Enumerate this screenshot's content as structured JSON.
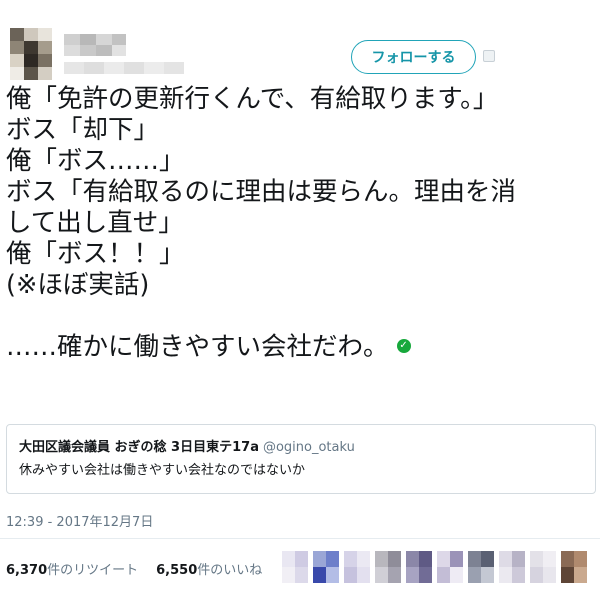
{
  "header": {
    "follow_label": "フォローする"
  },
  "tweet": {
    "lines": [
      "俺「免許の更新行くんで、有給取ります。」",
      "ボス「却下」",
      "俺「ボス……」",
      "ボス「有給取るのに理由は要らん。理由を消",
      "して出し直せ」",
      "俺「ボス！！」",
      "(※ほぼ実話)",
      "",
      "……確かに働きやすい会社だわ。"
    ]
  },
  "quote": {
    "author_name": "大田区議会議員 おぎの稔 3日目東テ17a",
    "author_handle": "@ogino_otaku",
    "text": "休みやすい会社は働きやすい会社なのではないか"
  },
  "timestamp": "12:39 - 2017年12月7日",
  "stats": {
    "retweets_count": "6,370",
    "retweets_label": "件のリツイート",
    "likes_count": "6,550",
    "likes_label": "件のいいね"
  },
  "colors": {
    "accent": "#1595a8",
    "verified": "#17a83c",
    "muted": "#657786"
  }
}
